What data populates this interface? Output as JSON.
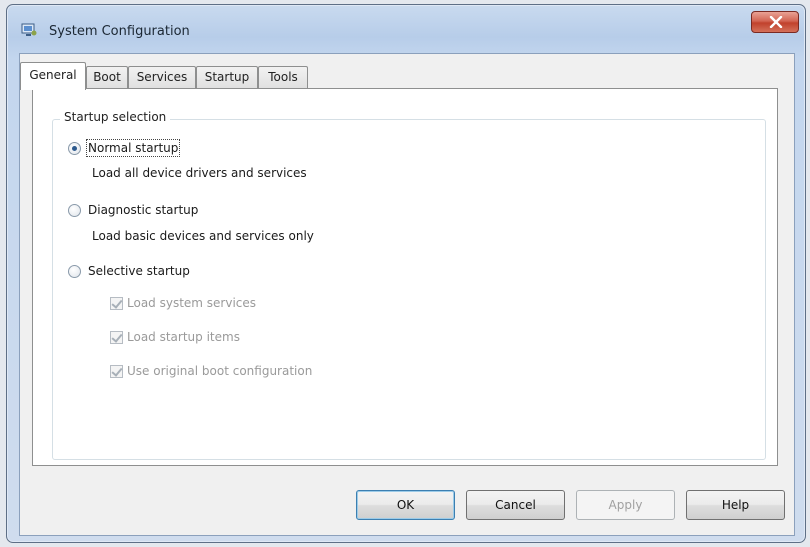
{
  "window": {
    "title": "System Configuration",
    "icon": "system-configuration-icon",
    "close_icon": "close-icon"
  },
  "tabs": [
    {
      "label": "General",
      "active": true
    },
    {
      "label": "Boot",
      "active": false
    },
    {
      "label": "Services",
      "active": false
    },
    {
      "label": "Startup",
      "active": false
    },
    {
      "label": "Tools",
      "active": false
    }
  ],
  "general": {
    "group_label": "Startup selection",
    "options": [
      {
        "label": "Normal startup",
        "description": "Load all device drivers and services",
        "selected": true
      },
      {
        "label": "Diagnostic startup",
        "description": "Load basic devices and services only",
        "selected": false
      },
      {
        "label": "Selective startup",
        "description": "",
        "selected": false
      }
    ],
    "selective_items": [
      {
        "label": "Load system services",
        "checked": true,
        "enabled": false
      },
      {
        "label": "Load startup items",
        "checked": true,
        "enabled": false
      },
      {
        "label": "Use original boot configuration",
        "checked": true,
        "enabled": false
      }
    ]
  },
  "buttons": {
    "ok": "OK",
    "cancel": "Cancel",
    "apply": "Apply",
    "help": "Help"
  },
  "colors": {
    "title_bar": "#c3d6ee",
    "close_button": "#c1412c",
    "default_button_border": "#3c7fb1"
  }
}
